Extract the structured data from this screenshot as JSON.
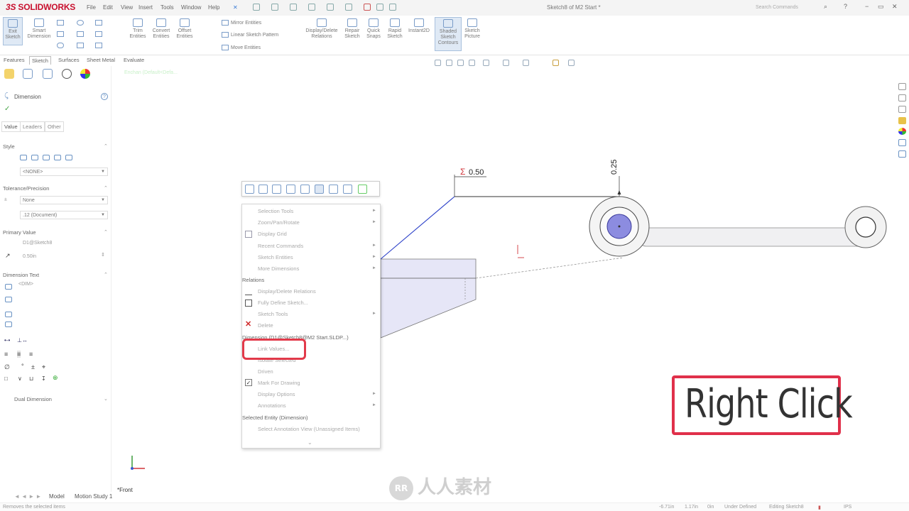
{
  "app": {
    "logo": "SOLIDWORKS",
    "menu": [
      "File",
      "Edit",
      "View",
      "Insert",
      "Tools",
      "Window",
      "Help"
    ],
    "document_title": "Sketch8 of M2 Start *",
    "search_placeholder": "Search Commands"
  },
  "command_manager": {
    "tools": [
      {
        "label": "Exit\nSketch",
        "active": true
      },
      {
        "label": "Smart\nDimension"
      },
      {
        "label": "Trim\nEntities"
      },
      {
        "label": "Convert\nEntities"
      },
      {
        "label": "Offset\nEntities"
      },
      {
        "label": "Display/Delete\nRelations"
      },
      {
        "label": "Repair\nSketch"
      },
      {
        "label": "Quick\nSnaps"
      },
      {
        "label": "Rapid\nSketch"
      },
      {
        "label": "Instant2D"
      },
      {
        "label": "Shaded\nSketch\nContours",
        "active": true
      },
      {
        "label": "Sketch\nPicture"
      }
    ],
    "row_tools": [
      "Mirror Entities",
      "Linear Sketch Pattern",
      "Move Entities"
    ]
  },
  "tabs": [
    "Features",
    "Sketch",
    "Surfaces",
    "Sheet Metal",
    "Evaluate"
  ],
  "active_tab": "Sketch",
  "tree_label": "Enchan (Default<Defa...",
  "property_manager": {
    "title": "Dimension",
    "help": "?",
    "subtabs": [
      "Value",
      "Leaders",
      "Other"
    ],
    "style": {
      "heading": "Style",
      "value": "<NONE>"
    },
    "tolerance": {
      "heading": "Tolerance/Precision",
      "tolerance_type": "None",
      "precision": ".12 (Document)"
    },
    "primary_value": {
      "heading": "Primary Value",
      "name": "D1@Sketch8",
      "value": "0.50in"
    },
    "dimension_text": {
      "heading": "Dimension Text",
      "text": "<DIM>"
    },
    "dual_dimension": "Dual Dimension"
  },
  "context_toolbar_icons": [
    "mate-icon",
    "flip-icon",
    "text-icon",
    "zoom-icon",
    "rotate-icon",
    "dimension-icon",
    "undo-icon",
    "save-icon",
    "appearance-icon"
  ],
  "context_menu": {
    "items": [
      {
        "label": "Selection Tools",
        "arrow": true
      },
      {
        "label": "Zoom/Pan/Rotate",
        "arrow": true
      },
      {
        "label": "Display Grid",
        "icon": "grid-icon"
      },
      {
        "label": "Recent Commands",
        "arrow": true
      },
      {
        "label": "Sketch Entities",
        "arrow": true
      },
      {
        "label": "More Dimensions",
        "arrow": true
      }
    ],
    "relations_header": "Relations",
    "relation_items": [
      {
        "label": "Display/Delete Relations",
        "icon": "relations-icon"
      },
      {
        "label": "Fully Define Sketch...",
        "icon": "fully-define-icon"
      },
      {
        "label": "Sketch Tools",
        "arrow": true
      },
      {
        "label": "Delete",
        "icon": "delete-icon"
      }
    ],
    "dimension_header": "Dimension (D1@Sketch8@M2 Start.SLDP...)",
    "dimension_items": [
      {
        "label": "Link Values..."
      },
      {
        "label": "Isolate Selected"
      },
      {
        "label": "Driven"
      },
      {
        "label": "Mark For Drawing",
        "checked": true
      },
      {
        "label": "Display Options",
        "arrow": true
      },
      {
        "label": "Annotations",
        "arrow": true
      }
    ],
    "selected_header": "Selected Entity (Dimension)",
    "selected_items": [
      {
        "label": "Select Annotation View (Unassigned Items)"
      }
    ],
    "more": "⌄"
  },
  "dimensions": {
    "horizontal": "0.50",
    "vertical": "0.25",
    "sigma": "Σ"
  },
  "callout": "Right Click",
  "view_label": "*Front",
  "bottom_tabs": [
    "Model",
    "Motion Study 1"
  ],
  "status": {
    "left": "Removes the selected items",
    "coord1": "-6.71in",
    "coord2": "1.17in",
    "coord3": "0in",
    "definition": "Under Defined",
    "editing": "Editing Sketch8",
    "units": "IPS"
  },
  "watermark": "人人素材",
  "colors": {
    "accent": "#c8102e",
    "highlight": "#e23a4a",
    "sketch_blue": "#2a3fc8",
    "fill_lavender": "#e6e6f7"
  }
}
